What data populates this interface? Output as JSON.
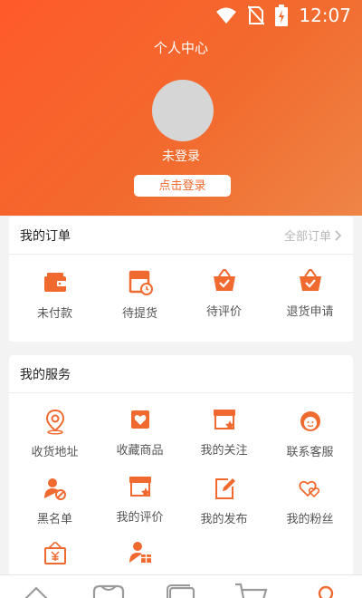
{
  "status_bar": {
    "time": "12:07",
    "icons": [
      "wifi-icon",
      "no-sim-icon",
      "battery-charging-icon"
    ]
  },
  "header": {
    "title": "个人中心",
    "login_state": "未登录",
    "login_button": "点击登录"
  },
  "orders": {
    "title": "我的订单",
    "all_orders": "全部订单",
    "items": [
      {
        "label": "未付款",
        "icon": "wallet-icon"
      },
      {
        "label": "待提货",
        "icon": "pickup-clock-icon"
      },
      {
        "label": "待评价",
        "icon": "basket-check-icon"
      },
      {
        "label": "退货申请",
        "icon": "basket-return-icon"
      }
    ]
  },
  "services": {
    "title": "我的服务",
    "items": [
      {
        "label": "收货地址",
        "icon": "location-pin-icon"
      },
      {
        "label": "收藏商品",
        "icon": "favorite-goods-icon"
      },
      {
        "label": "我的关注",
        "icon": "followed-store-icon"
      },
      {
        "label": "联系客服",
        "icon": "customer-service-icon"
      },
      {
        "label": "黑名单",
        "icon": "blocked-user-icon"
      },
      {
        "label": "我的评价",
        "icon": "store-review-icon"
      },
      {
        "label": "我的发布",
        "icon": "edit-post-icon"
      },
      {
        "label": "我的粉丝",
        "icon": "fans-hearts-icon"
      },
      {
        "label": "",
        "icon": "yuan-bill-icon"
      },
      {
        "label": "",
        "icon": "user-gift-icon"
      }
    ]
  },
  "tabbar": {
    "tabs": [
      "home-icon",
      "category-icon",
      "cards-icon",
      "cart-icon",
      "profile-icon"
    ],
    "active": "profile-icon"
  },
  "colors": {
    "accent": "#f06a2f",
    "header_start": "#ff5a2a",
    "header_end": "#ee8546"
  }
}
